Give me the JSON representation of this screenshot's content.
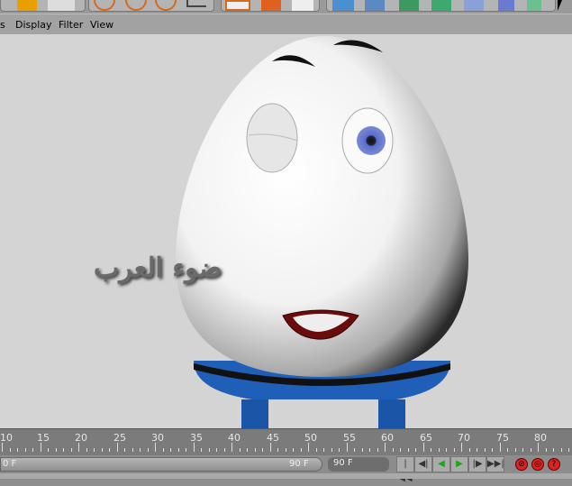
{
  "menu": {
    "items": [
      "s",
      "Display",
      "Filter",
      "View"
    ]
  },
  "toolbar": {
    "icons": [
      "layout-icon",
      "undo-icon",
      "move-icon",
      "scale-icon",
      "rotate-icon",
      "coord-icon",
      "render-view-icon",
      "render-settings-icon",
      "render-region-icon",
      "cube-icon",
      "spline-icon",
      "nurbs-icon",
      "array-icon",
      "deformer-icon",
      "scene-icon",
      "light-icon"
    ]
  },
  "viewport": {
    "watermark": "ضوء العرب"
  },
  "timeline": {
    "ticks": [
      "10",
      "15",
      "20",
      "25",
      "30",
      "35",
      "40",
      "45",
      "50",
      "55",
      "60",
      "65",
      "70",
      "75",
      "80"
    ]
  },
  "range": {
    "start": "0 F",
    "end": "90 F"
  },
  "frame_field": {
    "value": "90 F"
  },
  "playback": {
    "buttons": [
      "|◀◀",
      "◀|",
      "◀",
      "▶",
      "|▶",
      "▶▶|"
    ]
  },
  "record": {
    "buttons": [
      "⊘",
      "◎",
      "?"
    ]
  },
  "colors": {
    "viewport_bg": "#d4d4d4",
    "egg_base": "#1f5fb8"
  }
}
